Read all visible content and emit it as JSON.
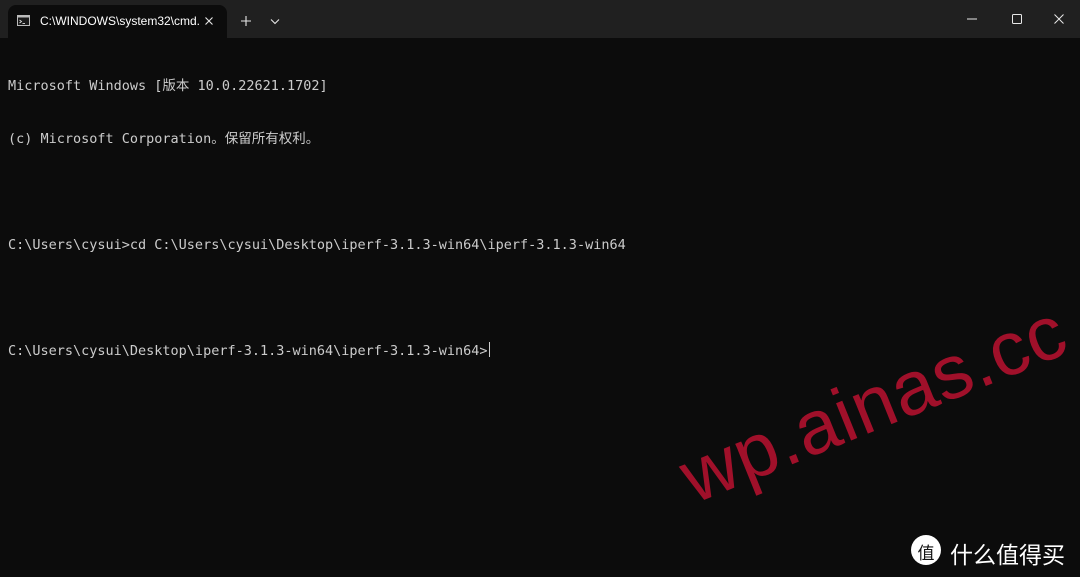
{
  "tab": {
    "title": "C:\\WINDOWS\\system32\\cmd.",
    "icon": "cmd-icon"
  },
  "titlebar": {
    "new_tab_icon": "plus-icon",
    "dropdown_icon": "chevron-down-icon",
    "minimize_icon": "minimize-icon",
    "maximize_icon": "maximize-icon",
    "close_icon": "close-icon"
  },
  "console": {
    "lines": [
      "Microsoft Windows [版本 10.0.22621.1702]",
      "(c) Microsoft Corporation。保留所有权利。",
      "",
      "C:\\Users\\cysui>cd C:\\Users\\cysui\\Desktop\\iperf-3.1.3-win64\\iperf-3.1.3-win64",
      "",
      "C:\\Users\\cysui\\Desktop\\iperf-3.1.3-win64\\iperf-3.1.3-win64>"
    ]
  },
  "watermark": {
    "text": "wp.ainas.cc",
    "color": "#a0102a"
  },
  "logo": {
    "badge_char": "值",
    "text": "什么值得买"
  },
  "colors": {
    "background": "#0c0c0c",
    "titlebar": "#202020",
    "text": "#cccccc"
  }
}
